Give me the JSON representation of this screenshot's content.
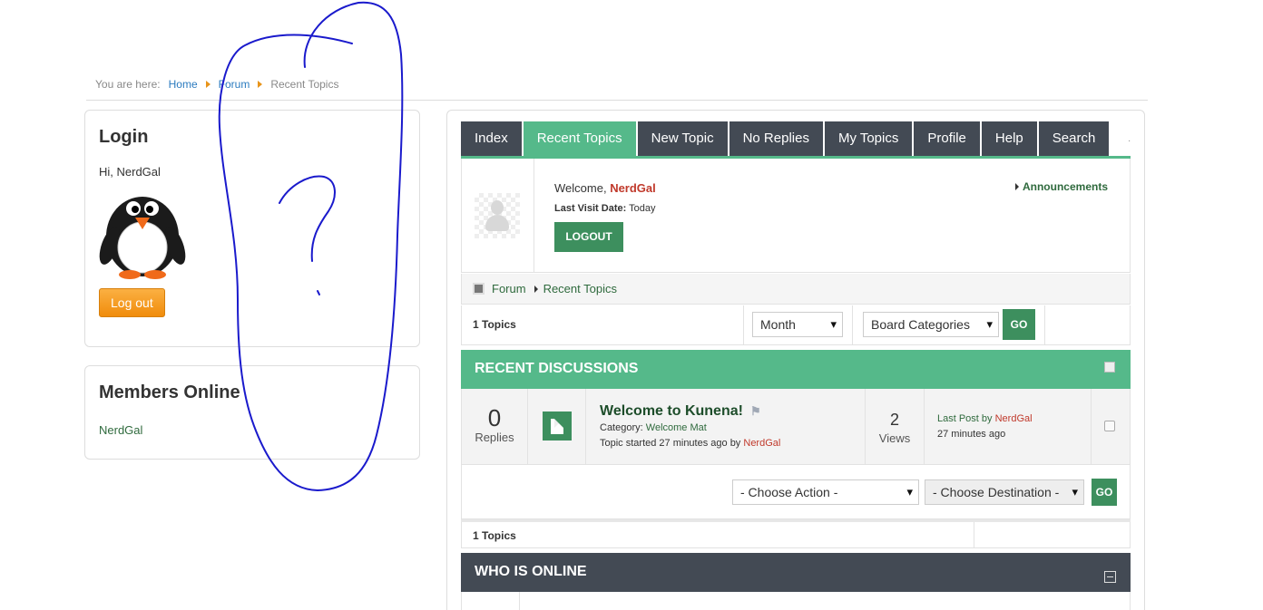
{
  "breadcrumb": {
    "prefix": "You are here:",
    "items": [
      "Home",
      "Forum",
      "Recent Topics"
    ]
  },
  "login_module": {
    "title": "Login",
    "greeting": "Hi, NerdGal",
    "logout_label": "Log out"
  },
  "members_module": {
    "title": "Members Online",
    "members": [
      "NerdGal"
    ]
  },
  "tabs": [
    {
      "label": "Index",
      "active": false
    },
    {
      "label": "Recent Topics",
      "active": true
    },
    {
      "label": "New Topic",
      "active": false
    },
    {
      "label": "No Replies",
      "active": false
    },
    {
      "label": "My Topics",
      "active": false
    },
    {
      "label": "Profile",
      "active": false
    },
    {
      "label": "Help",
      "active": false
    },
    {
      "label": "Search",
      "active": false
    }
  ],
  "profile": {
    "welcome": "Welcome,",
    "username": "NerdGal",
    "last_visit_label": "Last Visit Date:",
    "last_visit_value": "Today",
    "logout_label": "LOGOUT",
    "announcements_label": "Announcements"
  },
  "forum_crumbs": [
    "Forum",
    "Recent Topics"
  ],
  "filters": {
    "topic_count": "1 Topics",
    "time_select": "Month",
    "category_select": "Board Categories",
    "go_label": "GO"
  },
  "recent_discussions": {
    "title": "RECENT DISCUSSIONS",
    "topics": [
      {
        "replies": "0",
        "replies_label": "Replies",
        "title": "Welcome to Kunena!",
        "category_label": "Category:",
        "category": "Welcome Mat",
        "started": "Topic started 27 minutes ago by",
        "started_by": "NerdGal",
        "views": "2",
        "views_label": "Views",
        "last_post_label": "Last Post by",
        "last_post_by": "NerdGal",
        "last_post_time": "27 minutes ago"
      }
    ]
  },
  "actions": {
    "action_select": "- Choose Action -",
    "destination_select": "- Choose Destination -",
    "go_label": "GO"
  },
  "footer_count": "1 Topics",
  "who_is_online": {
    "title": "WHO IS ONLINE"
  },
  "colors": {
    "accent_green": "#55b98a",
    "dark_green": "#3d8f5e",
    "tab_dark": "#434a54",
    "username_red": "#c0392b",
    "scribble_blue": "#1a1acc"
  }
}
